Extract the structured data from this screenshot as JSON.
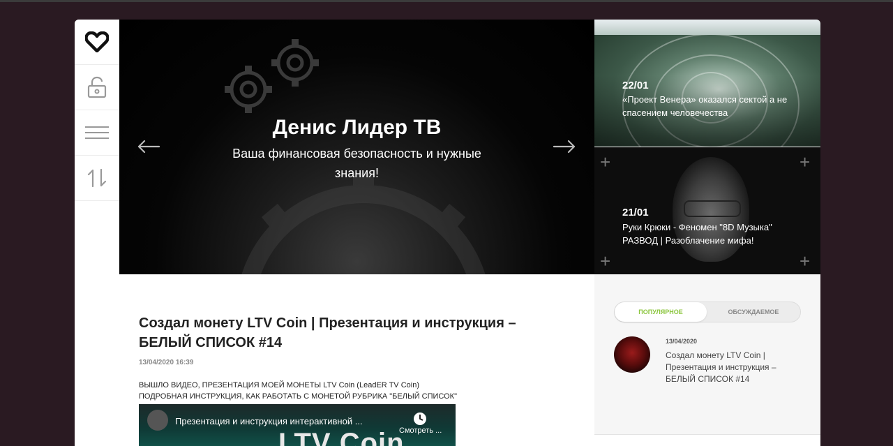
{
  "sidebar": {
    "items": [
      {
        "icon": "heart-icon"
      },
      {
        "icon": "lock-icon"
      },
      {
        "icon": "menu-icon"
      },
      {
        "icon": "sort-arrows-icon"
      }
    ]
  },
  "hero": {
    "title": "Денис Лидер ТВ",
    "subtitle": "Ваша финансовая безопасность и нужные знания!"
  },
  "news": [
    {
      "date": "22/01",
      "title": "«Проект Венера» оказался сектой а не спасением человечества"
    },
    {
      "date": "21/01",
      "title": "Руки Крюки - Феномен \"8D Музыка\" РАЗВОД | Разоблачение мифа!"
    }
  ],
  "article": {
    "title": "Создал монету LTV Coin | Презентация и инструкция – БЕЛЫЙ СПИСОК #14",
    "date": "13/04/2020 16:39",
    "body_line1": "ВЫШЛО ВИДЕО, ПРЕЗЕНТАЦИЯ МОЕЙ МОНЕТЫ LTV Coin (LeadER TV Coin)",
    "body_line2": "ПОДРОБНАЯ ИНСТРУКЦИЯ, КАК РАБОТАТЬ С МОНЕТОЙ РУБРИКА \"БЕЛЫЙ СПИСОК\"",
    "video": {
      "title": "Презентация и инструкция интерактивной ...",
      "watch_later": "Смотреть ...",
      "banner": "LTV Coin"
    }
  },
  "sidebar_right": {
    "tabs": [
      "ПОПУЛЯРНОЕ",
      "ОБСУЖДАЕМОЕ"
    ],
    "popular": [
      {
        "date": "13/04/2020",
        "title": "Создал монету LTV Coin | Презентация и инструкция – БЕЛЫЙ СПИСОК #14"
      }
    ]
  },
  "colors": {
    "page_bg": "#2a1a22",
    "accent_green": "#8cc63f"
  }
}
